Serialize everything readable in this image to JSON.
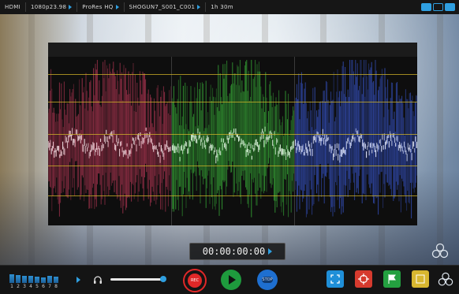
{
  "topbar": {
    "input": "HDMI",
    "format": "1080p23.98",
    "codec": "ProRes HQ",
    "clip": "SHOGUN7_S001_C001",
    "remaining": "1h 30m",
    "segments_extra": ""
  },
  "timecode": "00:00:00:00",
  "audio_meter": {
    "channels": [
      "1",
      "2",
      "3",
      "4",
      "5",
      "6",
      "7",
      "8"
    ],
    "levels": [
      0.62,
      0.55,
      0.48,
      0.52,
      0.44,
      0.4,
      0.5,
      0.46
    ]
  },
  "transport": {
    "rec_label": "REC",
    "stop_label": "STOP"
  },
  "colors": {
    "accent": "#2f9fe0",
    "rec": "#e02828",
    "play": "#1e9a3d",
    "stop": "#1e6fd0",
    "tool_blue": "#1f8fd8",
    "tool_red": "#d63a2e",
    "tool_green": "#24a040",
    "tool_yellow": "#d8b730",
    "wave_red": "#c23a5a",
    "wave_green": "#3dbf3d",
    "wave_blue": "#3a5ad8"
  },
  "icons": {
    "headphone": "headphone-icon",
    "focus": "focus-peaking-icon",
    "crosshair": "crosshair-icon",
    "flag": "tag-icon",
    "lut": "lut-icon",
    "logo": "atomos-logo-icon"
  }
}
